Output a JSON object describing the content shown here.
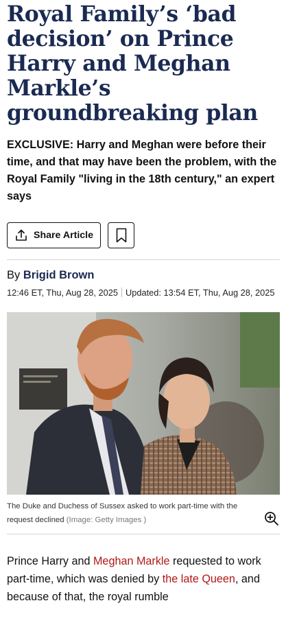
{
  "article": {
    "headline": "Royal Family’s ‘bad decision’ on Prince Harry and Meghan Markle’s groundbreaking plan",
    "standfirst": "EXCLUSIVE: Harry and Meghan were before their time, and that may have been the problem, with the Royal Family \"living in the 18th century,\" an expert says"
  },
  "actions": {
    "share_label": "Share Article",
    "share_icon": "share-icon",
    "bookmark_icon": "bookmark-icon"
  },
  "byline": {
    "prefix": "By",
    "author": "Brigid Brown",
    "published": "12:46 ET, Thu, Aug 28, 2025",
    "updated": "Updated: 13:54 ET, Thu, Aug 28, 2025"
  },
  "image": {
    "caption": "The Duke and Duchess of Sussex asked to work part-time with the request declined",
    "credit": "(Image: Getty Images )",
    "zoom_icon": "zoom-in-icon"
  },
  "body": {
    "p1_start": "Prince Harry and ",
    "link1": "Meghan Markle",
    "p1_mid": " requested to work part-time, which was denied by ",
    "link2": "the late Queen",
    "p1_end": ", and because of that, the royal rumble"
  },
  "colors": {
    "headline": "#1a2a52",
    "author": "#1a2a52",
    "link": "#b01818",
    "divider": "#d6d6d6"
  }
}
